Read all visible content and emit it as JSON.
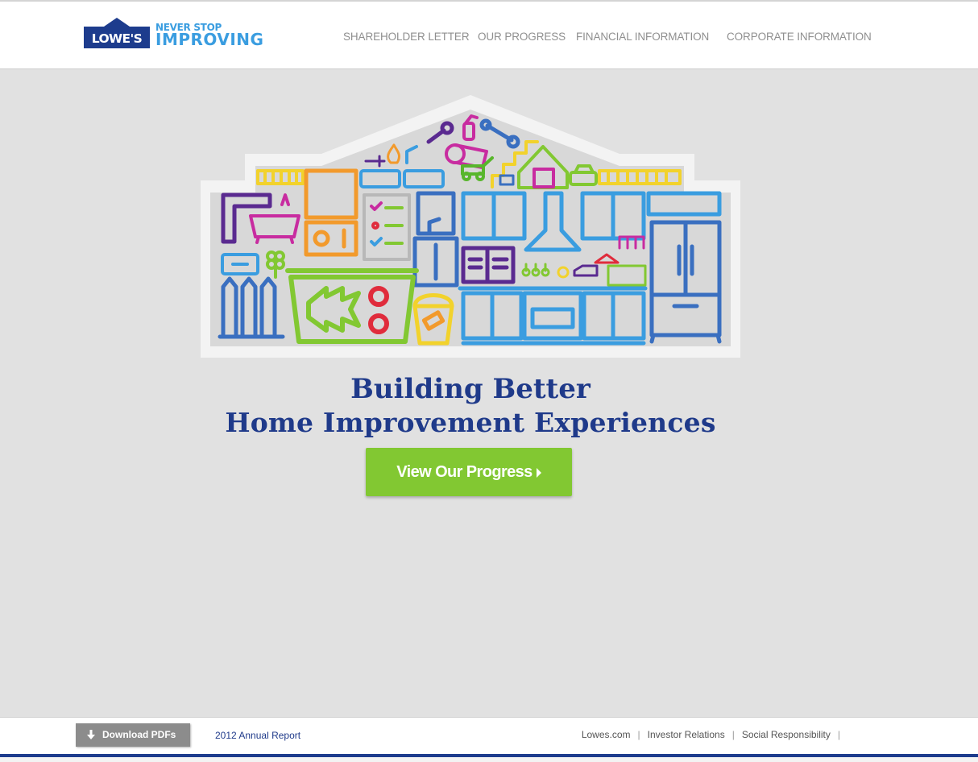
{
  "brand": {
    "logo_text": "LOWE'S",
    "tagline_top": "NEVER STOP",
    "tagline_bottom": "IMPROVING",
    "colors": {
      "navy": "#1f3a8a",
      "sky": "#3a9de0",
      "green": "#82c832"
    }
  },
  "nav": {
    "items": [
      {
        "label": "SHAREHOLDER LETTER"
      },
      {
        "label": "OUR PROGRESS"
      },
      {
        "label": "FINANCIAL INFORMATION"
      },
      {
        "label": "CORPORATE INFORMATION"
      }
    ]
  },
  "hero": {
    "illustration": "house-of-home-improvement-icons",
    "headline_line1": "Building Better",
    "headline_line2": "Home Improvement Experiences",
    "cta_label": "View Our Progress"
  },
  "footer": {
    "download_label": "Download PDFs",
    "report_label": "2012 Annual Report",
    "links": [
      {
        "label": "Lowes.com"
      },
      {
        "label": "Investor Relations"
      },
      {
        "label": "Social Responsibility"
      }
    ]
  }
}
